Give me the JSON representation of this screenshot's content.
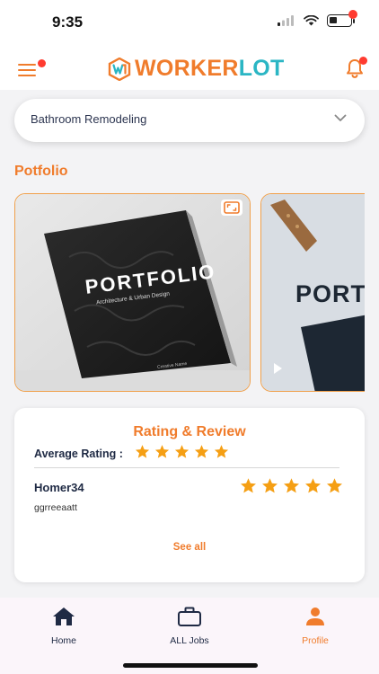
{
  "status_bar": {
    "time": "9:35"
  },
  "header": {
    "logo_part1": "WORKER",
    "logo_part2": "LOT",
    "colors": {
      "accent": "#f07c2c",
      "teal": "#2bb6c4",
      "notification": "#ff3b30"
    }
  },
  "service_select": {
    "value": "Bathroom Remodeling"
  },
  "portfolio": {
    "title": "Potfolio",
    "items": [
      {
        "cover_title": "PORTFOLIO",
        "cover_subtitle": "Architecture & Urban Design",
        "cover_author": "Creative Name"
      },
      {
        "cover_title": "PORT"
      }
    ]
  },
  "rating": {
    "title": "Rating & Review",
    "average_label": "Average Rating :",
    "average_stars": 5,
    "reviews": [
      {
        "name": "Homer34",
        "stars": 5,
        "text": "ggrreeaatt"
      }
    ],
    "see_all": "See all"
  },
  "tab_bar": {
    "tabs": [
      {
        "label": "Home",
        "icon": "home-icon",
        "active": false
      },
      {
        "label": "ALL Jobs",
        "icon": "briefcase-icon",
        "active": false
      },
      {
        "label": "Profile",
        "icon": "person-icon",
        "active": true
      }
    ]
  }
}
